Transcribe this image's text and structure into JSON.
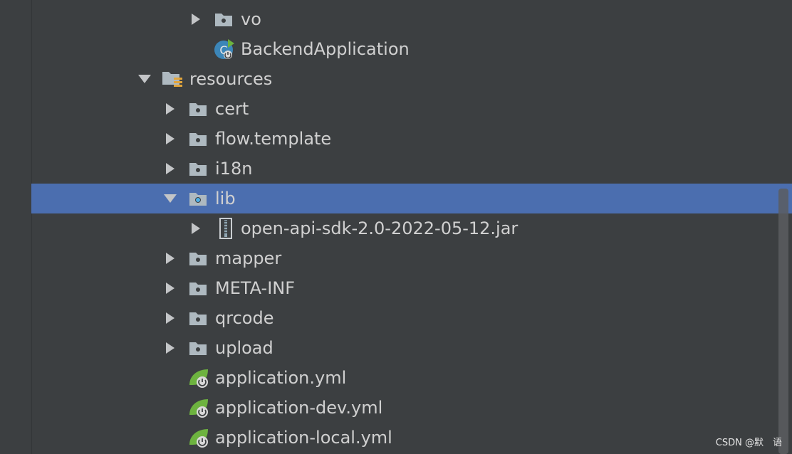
{
  "tree": {
    "items": [
      {
        "label": "vo",
        "type": "package",
        "expanded": false
      },
      {
        "label": "BackendApplication",
        "type": "spring-boot-class"
      },
      {
        "label": "resources",
        "type": "resources-root",
        "expanded": true
      },
      {
        "label": "cert",
        "type": "folder",
        "expanded": false
      },
      {
        "label": "flow.template",
        "type": "folder",
        "expanded": false
      },
      {
        "label": "i18n",
        "type": "folder",
        "expanded": false
      },
      {
        "label": "lib",
        "type": "folder",
        "expanded": true,
        "selected": true
      },
      {
        "label": "open-api-sdk-2.0-2022-05-12.jar",
        "type": "jar",
        "expanded": false
      },
      {
        "label": "mapper",
        "type": "folder",
        "expanded": false
      },
      {
        "label": "META-INF",
        "type": "folder",
        "expanded": false
      },
      {
        "label": "qrcode",
        "type": "folder",
        "expanded": false
      },
      {
        "label": "upload",
        "type": "folder",
        "expanded": false
      },
      {
        "label": "application.yml",
        "type": "spring-yml"
      },
      {
        "label": "application-dev.yml",
        "type": "spring-yml"
      },
      {
        "label": "application-local.yml",
        "type": "spring-yml"
      }
    ]
  },
  "watermark": "CSDN @默　语",
  "colors": {
    "background": "#3c3f41",
    "selection": "#4b6eaf",
    "folder": "#aeb9c0",
    "spring": "#6db33f"
  }
}
